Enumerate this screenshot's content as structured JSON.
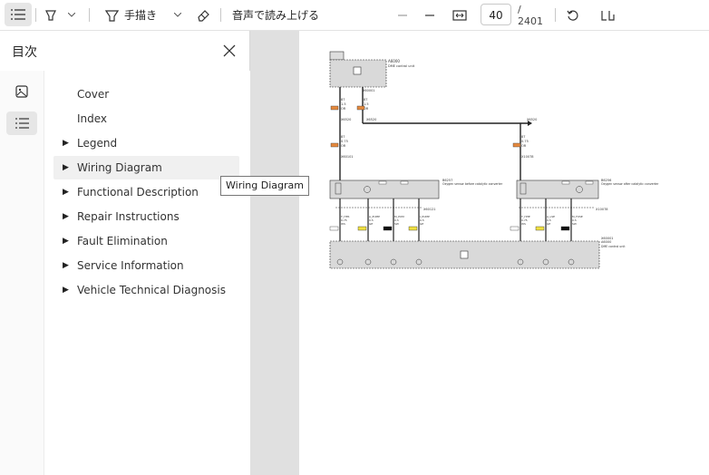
{
  "toolbar": {
    "draw_label": "手描き",
    "read_aloud_label": "音声で読み上げる",
    "page_current": "40",
    "page_total": "/ 2401"
  },
  "toc": {
    "title": "目次",
    "items": [
      {
        "label": "Cover",
        "expandable": false
      },
      {
        "label": "Index",
        "expandable": false
      },
      {
        "label": "Legend",
        "expandable": true
      },
      {
        "label": "Wiring Diagram",
        "expandable": true
      },
      {
        "label": "Functional Description",
        "expandable": true
      },
      {
        "label": "Repair Instructions",
        "expandable": true
      },
      {
        "label": "Fault Elimination",
        "expandable": true
      },
      {
        "label": "Service Information",
        "expandable": true
      },
      {
        "label": "Vehicle Technical Diagnosis",
        "expandable": true
      }
    ]
  },
  "tooltip": "Wiring Diagram",
  "diagram": {
    "top_box_id": "A6000",
    "top_box_desc": "DME control unit",
    "conn_top": "X60001",
    "wire_left": "X6520",
    "wire_left2": "X6520",
    "wire_right": "X6520",
    "wire_rt": "X6520",
    "splice_left": "X60101",
    "splice_right": "X10078",
    "sensor_left_id": "B6257",
    "sensor_left_desc": "Oxygen sensor before catalytic converter",
    "sensor_right_id": "B6256",
    "sensor_right_desc": "Oxygen sensor after catalytic converter",
    "conn_mid": "X60121",
    "conn_mid2": "X10078",
    "bottom_box_id": "A6000",
    "bottom_box_desc": "DME control unit",
    "conn_bottom": "X60001",
    "wire_specs": [
      {
        "num": "87",
        "size": "1.5",
        "color": "OR"
      },
      {
        "num": "87",
        "size": "1.5",
        "color": "OR"
      },
      {
        "num": "87",
        "size": "0.75",
        "color": "OR"
      },
      {
        "num": "87",
        "size": "0.75",
        "color": "OR"
      }
    ],
    "lower_wires": [
      {
        "name": "T_HTR",
        "size": "0.75",
        "color": "WS"
      },
      {
        "name": "A_PUMP",
        "size": "0.5",
        "color": "GE"
      },
      {
        "name": "M_PUM",
        "size": "0.5",
        "color": "SW"
      },
      {
        "name": "I_PUMP",
        "size": "0.5",
        "color": "GE"
      },
      {
        "name": "T_HHE",
        "size": "0.75",
        "color": "WS"
      },
      {
        "name": "A_LSE",
        "size": "0.5",
        "color": "GE"
      },
      {
        "name": "M_FUSE",
        "size": "0.5",
        "color": "SW"
      }
    ]
  }
}
